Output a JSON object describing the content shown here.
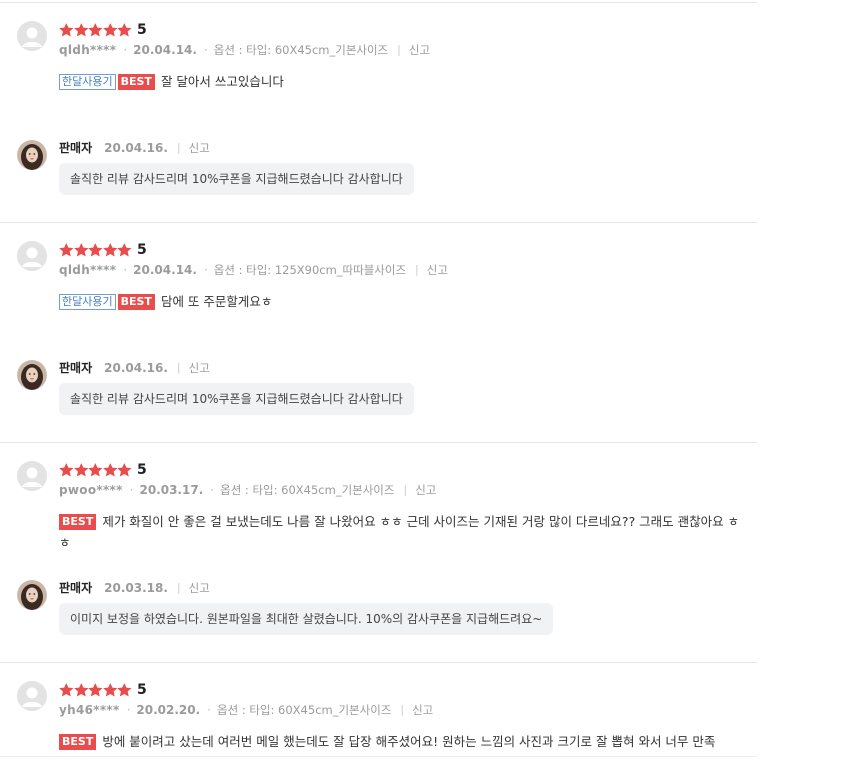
{
  "reviews": [
    {
      "score": "5",
      "user": "qldh****",
      "date": "20.04.14.",
      "option": "옵션 : 타입: 60X45cm_기본사이즈",
      "report": "신고",
      "tag_month": "한달사용기",
      "tag_best": "BEST",
      "text": "잘 달아서 쓰고있습니다",
      "reply": {
        "seller": "판매자",
        "date": "20.04.16.",
        "report": "신고",
        "text": "솔직한 리뷰 감사드리며 10%쿠폰을 지급해드렸습니다 감사합니다"
      }
    },
    {
      "score": "5",
      "user": "qldh****",
      "date": "20.04.14.",
      "option": "옵션 : 타입: 125X90cm_따따블사이즈",
      "report": "신고",
      "tag_month": "한달사용기",
      "tag_best": "BEST",
      "text": "담에 또 주문할게요ㅎ",
      "reply": {
        "seller": "판매자",
        "date": "20.04.16.",
        "report": "신고",
        "text": "솔직한 리뷰 감사드리며 10%쿠폰을 지급해드렸습니다 감사합니다"
      }
    },
    {
      "score": "5",
      "user": "pwoo****",
      "date": "20.03.17.",
      "option": "옵션 : 타입: 60X45cm_기본사이즈",
      "report": "신고",
      "tag_best": "BEST",
      "text": "제가 화질이 안 좋은 걸 보냈는데도 나름 잘 나왔어요 ㅎㅎ 근데 사이즈는 기재된 거랑 많이 다르네요?? 그래도 괜찮아요 ㅎㅎ",
      "reply": {
        "seller": "판매자",
        "date": "20.03.18.",
        "report": "신고",
        "text": "이미지 보정을 하였습니다. 원본파일을 최대한 살렸습니다. 10%의 감사쿠폰을 지급해드려요~"
      }
    },
    {
      "score": "5",
      "user": "yh46****",
      "date": "20.02.20.",
      "option": "옵션 : 타입: 60X45cm_기본사이즈",
      "report": "신고",
      "tag_best": "BEST",
      "text": "방에 붙이려고 샀는데 여러번 메일 했는데도 잘 답장 해주셨어요! 원하는 느낌의 사진과 크기로 잘 뽑혀 와서 너무 만족"
    }
  ],
  "colors": {
    "star": "#e84c4c",
    "best_badge": "#e84c4c",
    "month_tag_border": "#6f9ed8",
    "bubble_bg": "#f1f2f4"
  }
}
